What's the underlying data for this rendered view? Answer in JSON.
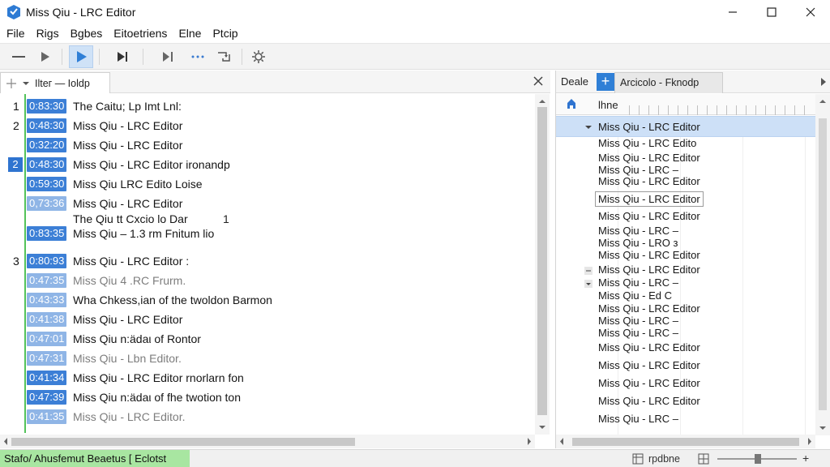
{
  "window": {
    "title": "Miss Qiu - LRC Editor",
    "minimize_icon": "minimize-icon",
    "maximize_icon": "maximize-icon",
    "close_icon": "close-icon"
  },
  "menu": [
    "File",
    "Rigs",
    "Bgbes",
    "Eitoetriens",
    "Elne",
    "Ptcip"
  ],
  "toolbar": {
    "buttons": [
      "stop-icon",
      "play-icon",
      "play-active-icon",
      "next-icon",
      "step-icon",
      "dots-icon",
      "loop-icon",
      "settings-icon"
    ]
  },
  "left_panel": {
    "tab_label": "Ilteг — Ioldp",
    "rows": [
      {
        "num": "1",
        "ts": "0:83:30",
        "text": "The Caitu; Lp Imt Lnl:",
        "pale": false
      },
      {
        "num": "2",
        "ts": "0:48:30",
        "text": "Miss Qiu - LRC Editor",
        "pale": false
      },
      {
        "num": "",
        "ts": "0:32:20",
        "text": "Miss Qiu - LRC Editor",
        "pale": false
      },
      {
        "num": "2",
        "ts": "0:48:30",
        "text": "Miss Qiu - LRC Editor ironandp",
        "pale": false,
        "selected": true
      },
      {
        "num": "",
        "ts": "0:59:30",
        "text": "Miss Qiu  LRC Edito Loise",
        "pale": false
      },
      {
        "num": "",
        "ts": "0,73:36",
        "text": "Miss Qiu - LRC Editor",
        "pale": true
      },
      {
        "num": "",
        "ts": "",
        "text": "The Qiu tt Cxcio lo Dar",
        "pale": false,
        "extra": "1"
      },
      {
        "num": "",
        "ts": "0:83:35",
        "text": "Miss Qiu – 1.3 rm Fnitum lio",
        "pale": false
      },
      {
        "num": "3",
        "ts": "0:80:93",
        "text": "Miss Qiu - LRC Editor :",
        "pale": false
      },
      {
        "num": "",
        "ts": "0:47:35",
        "text": "Miss Qiu 4 .RC Frurm.",
        "pale": true,
        "faint": true
      },
      {
        "num": "",
        "ts": "0:43:33",
        "text": "Wha Chkess,ian of the twoldon Barmon",
        "pale": true
      },
      {
        "num": "",
        "ts": "0:41:38",
        "text": "Miss Qiu - LRC Editor",
        "pale": true
      },
      {
        "num": "",
        "ts": "0:47:01",
        "text": "Miss Qiu n:ädaι of Rontor",
        "pale": true
      },
      {
        "num": "",
        "ts": "0:47:31",
        "text": "Miss Qiu - Lbn Editor.",
        "pale": true,
        "faint": true
      },
      {
        "num": "",
        "ts": "0:41:34",
        "text": "Miss Qiu - LRC Editor rnorlarn fon",
        "pale": false
      },
      {
        "num": "",
        "ts": "0:47:39",
        "text": "Miss Qiu n:ädaι of fhe twotion ton",
        "pale": false
      },
      {
        "num": "",
        "ts": "0:41:35",
        "text": "Miss Qiu - LRC Editor.",
        "pale": true,
        "faint": true
      }
    ]
  },
  "right_panel": {
    "tab1": "Deale",
    "tab2": "Arcicolo - Fknodp",
    "col_label": "lhne",
    "rows": [
      {
        "text": "Miss Qiu - LRC Editor",
        "selected": true,
        "icon": "collapse"
      },
      {
        "text": "Miss Qiu - LRC Edito"
      },
      {
        "text": "Miss Qiu - LRC Editor"
      },
      {
        "text": "Miss Qiu - LRC –"
      },
      {
        "text": "Miss Qiu - LRC Editor"
      },
      {
        "text": "Miss Qiu - LRC Editor",
        "boxed": true
      },
      {
        "text": "Miss Qiu - LRC Editor"
      },
      {
        "text": "Miss Qiu - LRC –"
      },
      {
        "text": "Miss Qiu - LRO з"
      },
      {
        "text": "Miss Qiu - LRC Editor"
      },
      {
        "text": "Miss Qiu - LRC Editor",
        "icon": "minus"
      },
      {
        "text": "Miss Qiu - LRC –",
        "icon": "expand"
      },
      {
        "text": "Miss Qiu - Ed C"
      },
      {
        "text": "Miss Qiu - LRC Editor"
      },
      {
        "text": "Miss Qiu - LRC –"
      },
      {
        "text": "Miss Qiu - LRC –"
      },
      {
        "text": "Miss Qiu - LRC Editor"
      },
      {
        "text": "Miss Qiu - LRC Editor"
      },
      {
        "text": "Miss Qiu - LRC Editor"
      },
      {
        "text": "Miss Qiu - LRC Editor"
      },
      {
        "text": "Miss Qiu - LRC –"
      }
    ]
  },
  "status": {
    "left_text": "Stafo/  Ahusfemut Beaetus [ Eclotst",
    "right_label": "rpdbne"
  }
}
